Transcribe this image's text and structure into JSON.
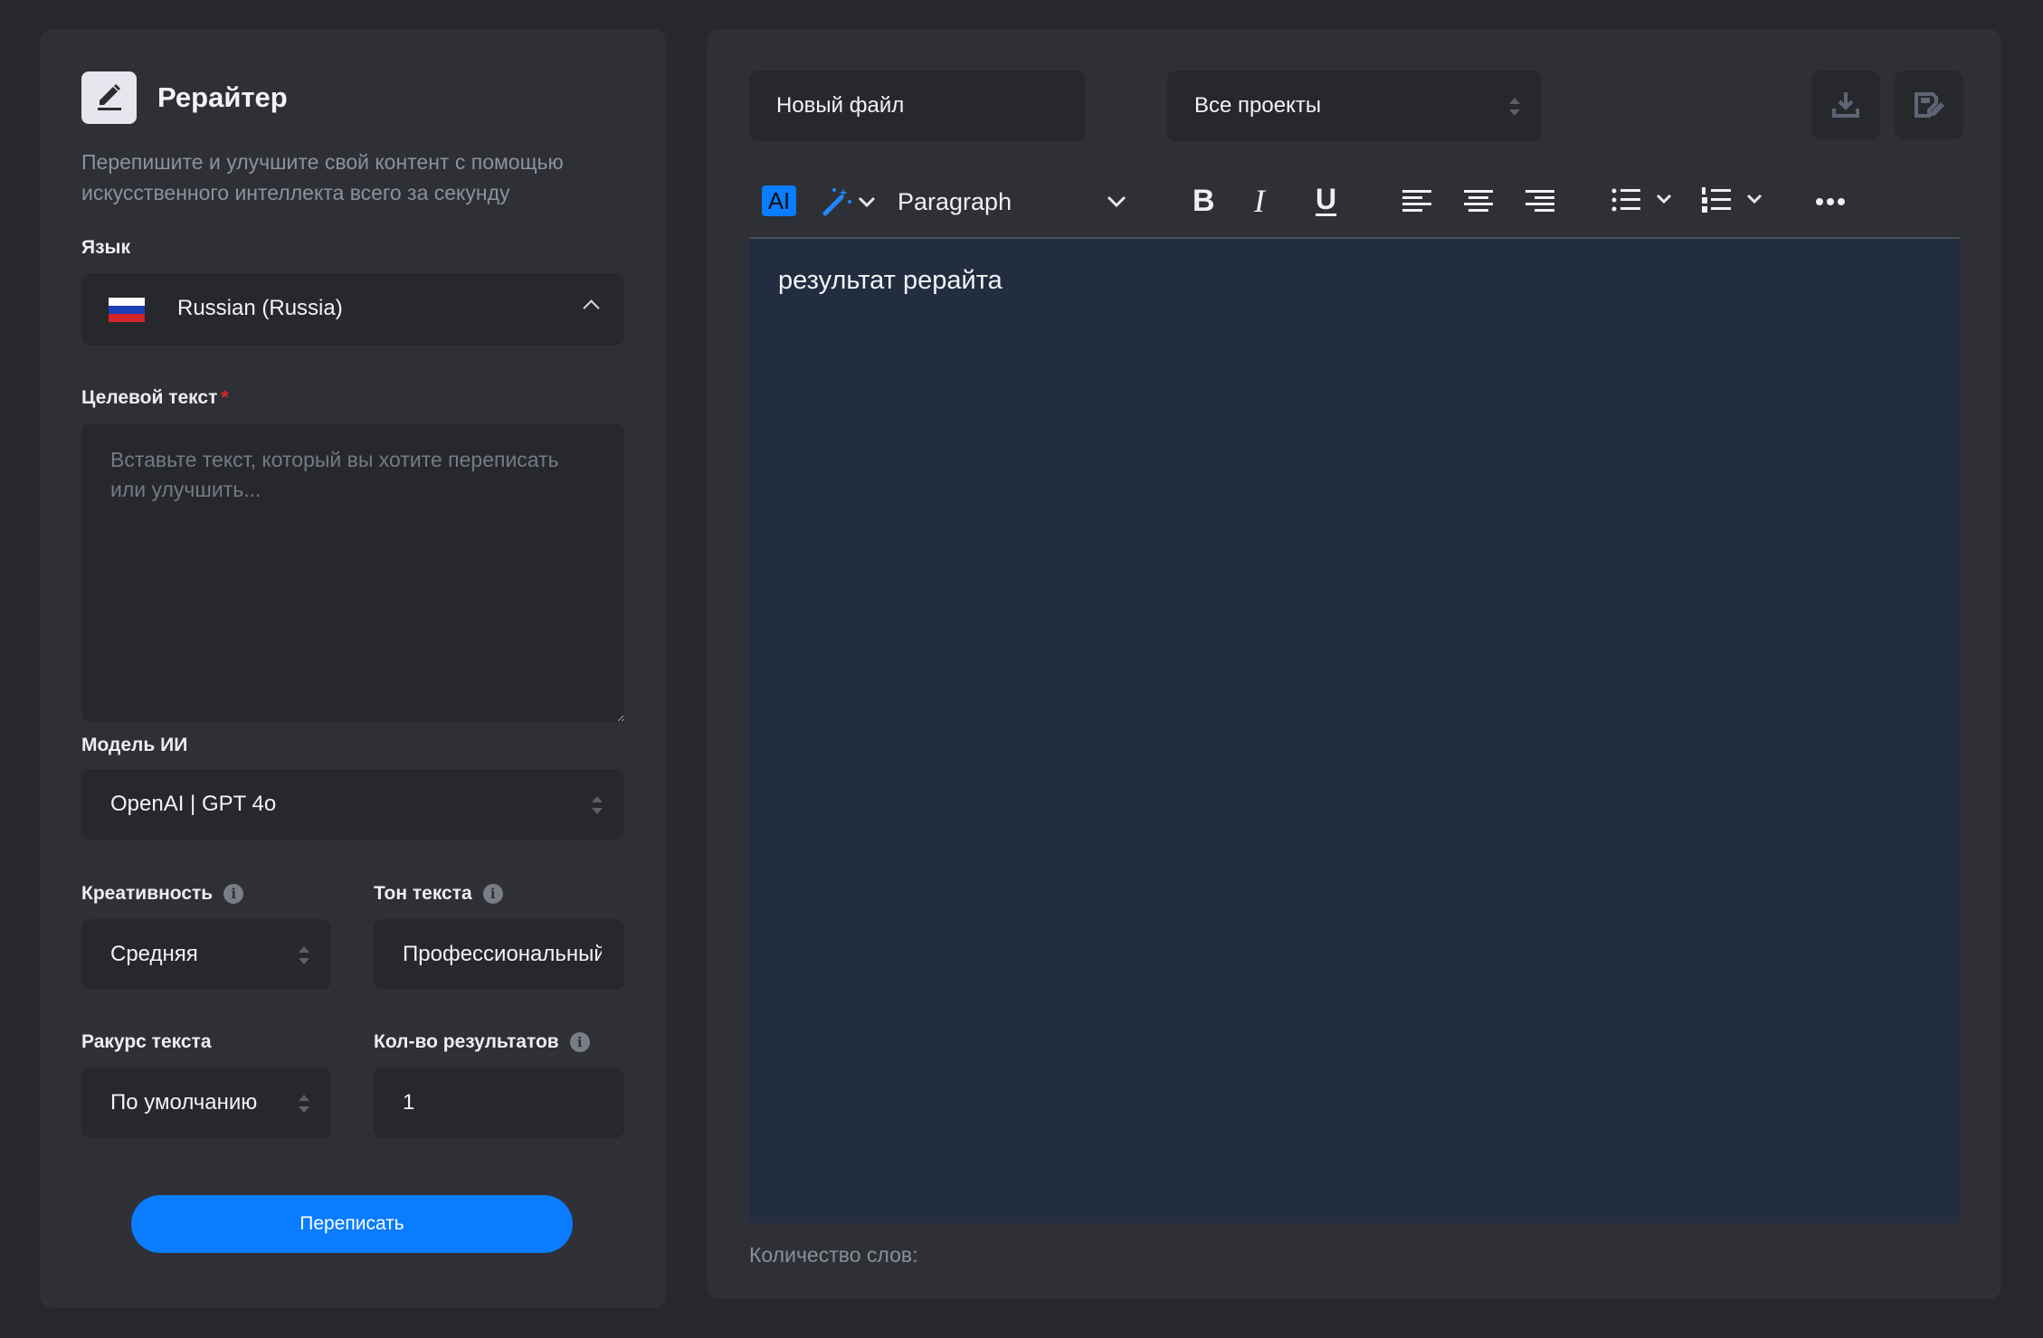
{
  "sidebar": {
    "icon": "pen-edit-icon",
    "title": "Рерайтер",
    "description": "Перепишите и улучшите свой контент с помощью искусственного интеллекта всего за секунду",
    "language": {
      "label": "Язык",
      "value": "Russian (Russia)",
      "flag_icon": "russia-flag-icon"
    },
    "target_text": {
      "label": "Целевой текст",
      "required_mark": "*",
      "placeholder": "Вставьте текст, который вы хотите переписать или улучшить...",
      "value": ""
    },
    "model": {
      "label": "Модель ИИ",
      "value": "OpenAI | GPT 4o"
    },
    "creativity": {
      "label": "Креативность",
      "value": "Средняя"
    },
    "tone": {
      "label": "Тон текста",
      "value": "Профессиональный"
    },
    "perspective": {
      "label": "Ракурс текста",
      "value": "По умолчанию"
    },
    "results_count": {
      "label": "Кол-во результатов",
      "value": "1"
    },
    "submit_label": "Переписать",
    "info_glyph": "i"
  },
  "editor": {
    "file_name": "Новый файл",
    "project": "Все проекты",
    "toolbar": {
      "ai_label": "AI",
      "block_style": "Paragraph",
      "bold": "B",
      "italic": "I",
      "underline": "U"
    },
    "content": "результат рерайта",
    "word_count_label": "Количество слов:"
  },
  "colors": {
    "background": "#27282c",
    "panel": "#2f3035",
    "accent": "#0a7cff",
    "editor_bg": "#222e40",
    "required": "#e0242b"
  }
}
